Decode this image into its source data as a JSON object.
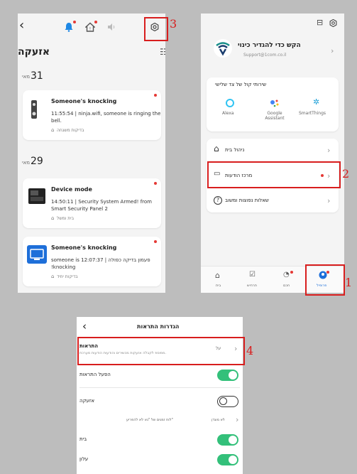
{
  "callouts": [
    "1",
    "2",
    "3",
    "4"
  ],
  "left": {
    "back_icon": "‹",
    "title": "אזעקה",
    "date1": {
      "day": "31",
      "month": "מאי"
    },
    "card1": {
      "title": "Someone's knocking",
      "line1": "11:55:54 | ninja.wifi, someone is ringing the",
      "line2": "bell.",
      "place": "בדיקות משגחה"
    },
    "date2": {
      "day": "29",
      "month": "מאי"
    },
    "card2": {
      "title": "Device mode",
      "line1": "14:50:11 | Security System Armed! from",
      "line2": "Smart Security Panel 2",
      "place": "בית ומשל"
    },
    "card3": {
      "title": "Someone's knocking",
      "line1": "someone is פעמון בדיקה כפולה | 12:07:37",
      "line2": "!knocking",
      "place": "בדיקות יחיד"
    }
  },
  "right": {
    "profile": {
      "name": "הקש כדי להגדיר כינוי",
      "email": "Support@1com.co.il"
    },
    "services_title": "שירותי קול של צד שלישי",
    "services": [
      {
        "label": "Alexa"
      },
      {
        "label": "Google\nAssistant"
      },
      {
        "label": "SmartThings"
      }
    ],
    "menu": [
      {
        "label": "ניהול בית"
      },
      {
        "label": "מרכז הודעות"
      },
      {
        "label": "שאלות נפוצות ומשוב"
      }
    ],
    "tabs": [
      {
        "label": "בית"
      },
      {
        "label": "תרחיש"
      },
      {
        "label": "חכם"
      },
      {
        "label": "פרופיל"
      }
    ]
  },
  "bottom": {
    "back_icon": "‹",
    "title": "הגדרות התראות",
    "alerts": {
      "label": "התראות",
      "desc": "מפוספ לקבלה אזעקות מכשירים והודעות הודעות מערכת.",
      "value": "על"
    },
    "rows": [
      {
        "label": "הפעל התראות"
      },
      {
        "label": "אזעקה"
      },
      {
        "label": "לוח זמנים של \"נא לא להפריע\"",
        "value": "לא מוגדן"
      },
      {
        "label": "בית"
      },
      {
        "label": "עלון"
      }
    ]
  }
}
